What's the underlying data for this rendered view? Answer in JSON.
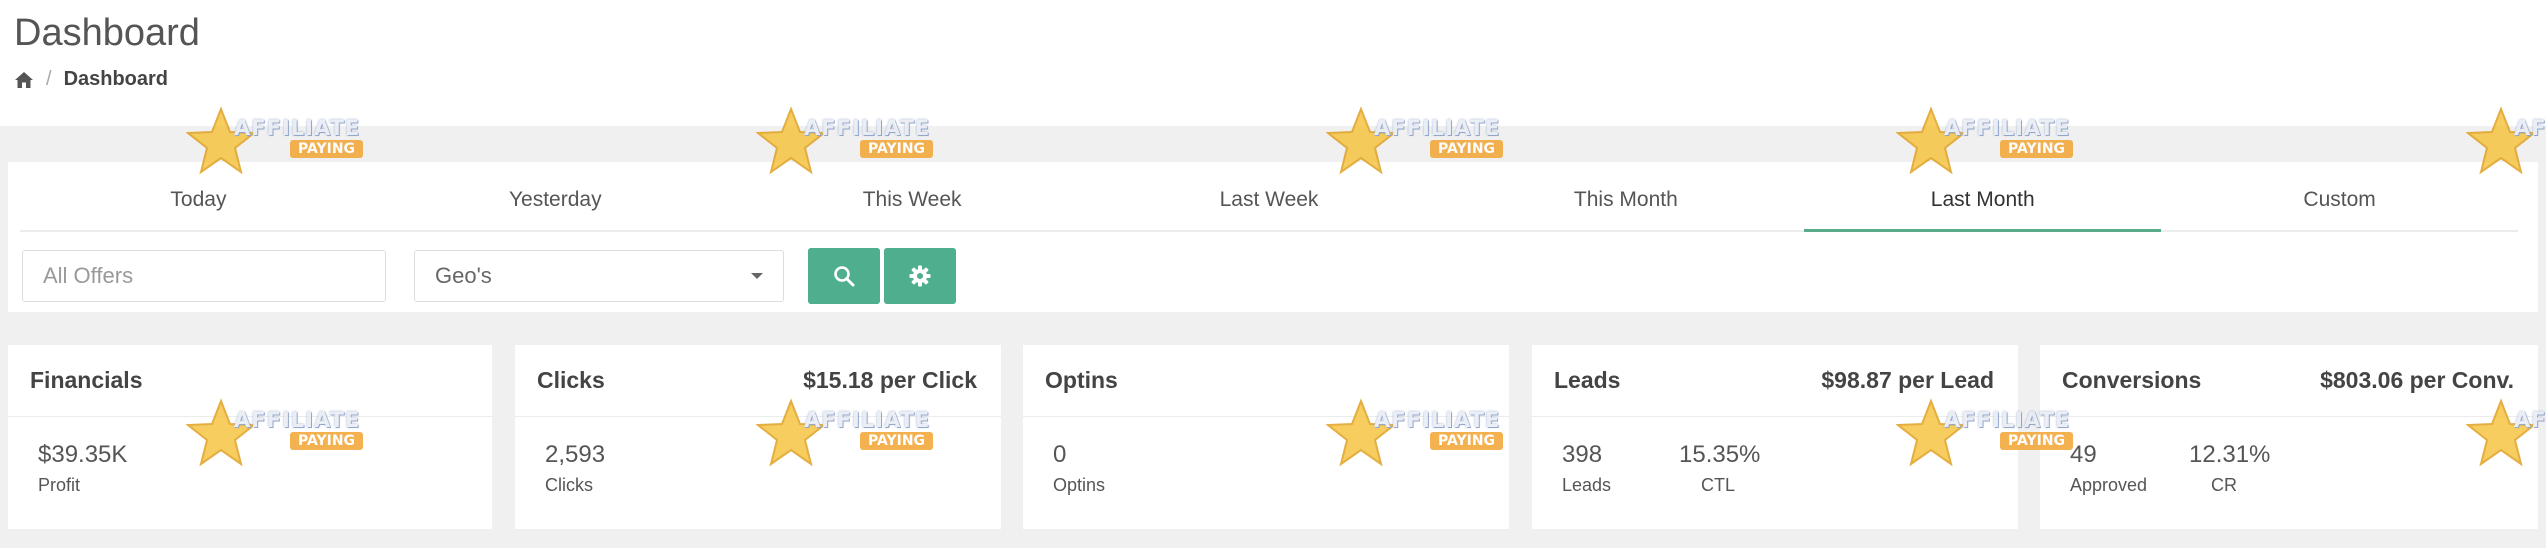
{
  "page": {
    "title": "Dashboard"
  },
  "breadcrumb": {
    "home_icon": "home-icon",
    "separator": "/",
    "current": "Dashboard"
  },
  "tabs": [
    {
      "label": "Today",
      "active": false
    },
    {
      "label": "Yesterday",
      "active": false
    },
    {
      "label": "This Week",
      "active": false
    },
    {
      "label": "Last Week",
      "active": false
    },
    {
      "label": "This Month",
      "active": false
    },
    {
      "label": "Last Month",
      "active": true
    },
    {
      "label": "Custom",
      "active": false
    }
  ],
  "filters": {
    "offers_placeholder": "All Offers",
    "geo_selected": "Geo's",
    "search_icon": "search-icon",
    "settings_icon": "gear-icon"
  },
  "cards": {
    "financials": {
      "title": "Financials",
      "metrics": [
        {
          "value": "$39.35K",
          "label": "Profit"
        }
      ]
    },
    "clicks": {
      "title": "Clicks",
      "rate": "$15.18 per Click",
      "metrics": [
        {
          "value": "2,593",
          "label": "Clicks"
        }
      ]
    },
    "optins": {
      "title": "Optins",
      "metrics": [
        {
          "value": "0",
          "label": "Optins"
        }
      ]
    },
    "leads": {
      "title": "Leads",
      "rate": "$98.87 per Lead",
      "metrics": [
        {
          "value": "398",
          "label": "Leads"
        },
        {
          "value": "15.35%",
          "label": "CTL"
        }
      ]
    },
    "conversions": {
      "title": "Conversions",
      "rate": "$803.06 per Conv.",
      "metrics": [
        {
          "value": "49",
          "label": "Approved"
        },
        {
          "value": "12.31%",
          "label": "CR"
        }
      ]
    }
  },
  "watermark": {
    "text": "AFFILIATE",
    "sub": "PAYING"
  },
  "colors": {
    "accent": "#4fae8d",
    "tab_underline": "#5aaa8c",
    "band": "#f0f0f0"
  }
}
